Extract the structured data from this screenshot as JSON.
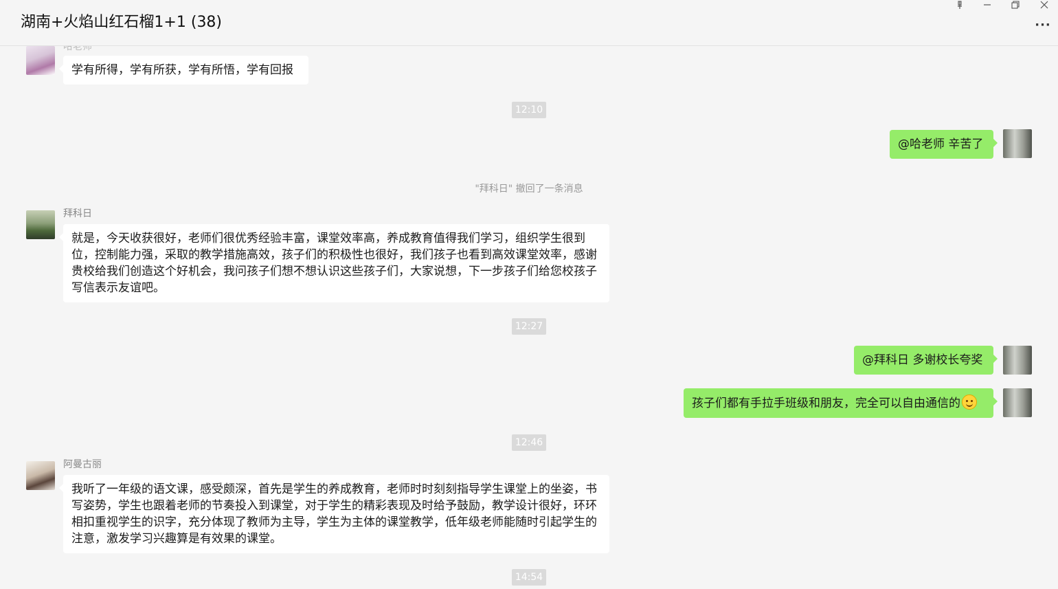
{
  "window": {
    "title": "湖南+火焰山红石榴1+1 (38)",
    "controls": {
      "pin": "⊥",
      "minimize": "—",
      "restore": "❐",
      "close": "✕",
      "more": "···"
    }
  },
  "messages": [
    {
      "sender": "哈老师",
      "text": "学有所得，学有所获，学有所悟，学有回报"
    },
    {
      "time": "12:10"
    },
    {
      "text": "@哈老师 辛苦了"
    },
    {
      "recall": "\"拜科日\" 撤回了一条消息"
    },
    {
      "sender": "拜科日",
      "text": "就是，今天收获很好，老师们很优秀经验丰富，课堂效率高，养成教育值得我们学习，组织学生很到位，控制能力强，采取的教学措施高效，孩子们的积极性也很好，我们孩子也看到高效课堂效率，感谢贵校给我们创造这个好机会，我问孩子们想不想认识这些孩子们，大家说想，下一步孩子们给您校孩子写信表示友谊吧。"
    },
    {
      "time": "12:27"
    },
    {
      "text": "@拜科日 多谢校长夸奖"
    },
    {
      "text": "孩子们都有手拉手班级和朋友，完全可以自由通信的"
    },
    {
      "time": "12:46"
    },
    {
      "sender": "阿曼古丽",
      "text": "我听了一年级的语文课，感受颇深，首先是学生的养成教育，老师时时刻刻指导学生课堂上的坐姿，书写姿势，学生也跟着老师的节奏投入到课堂，对于学生的精彩表现及时给予鼓励，教学设计很好，环环相扣重视学生的识字，充分体现了教师为主导，学生为主体的课堂教学，低年级老师能随时引起学生的注意，激发学习兴趣算是有效果的课堂。"
    },
    {
      "time": "14:54"
    }
  ],
  "colors": {
    "background": "#f5f5f5",
    "incoming_bubble": "#ffffff",
    "outgoing_bubble": "#95ec69",
    "time_badge": "#dadada"
  },
  "icons": {
    "smile_emoji": "smiling-face-emoji"
  }
}
